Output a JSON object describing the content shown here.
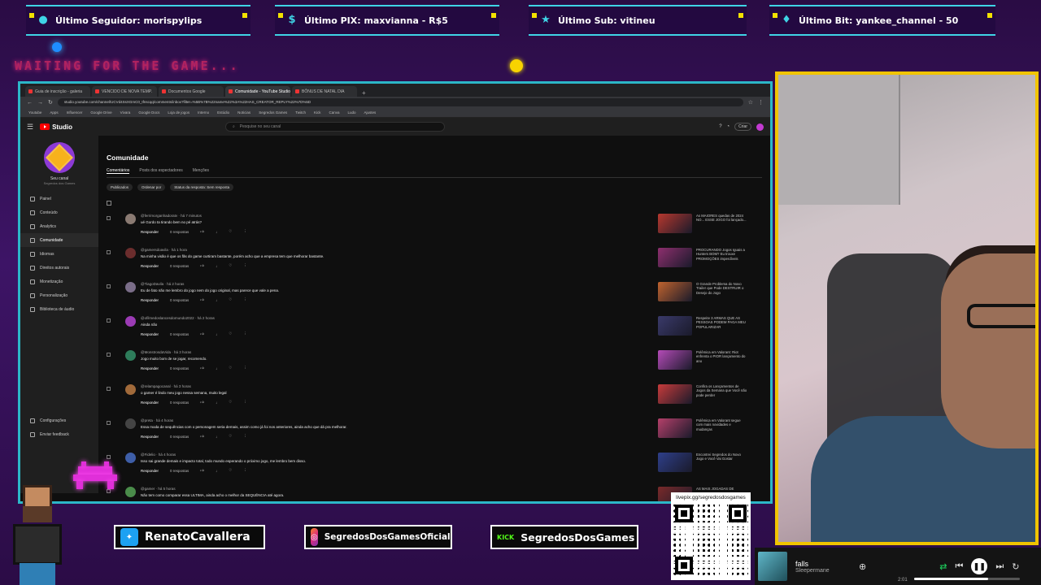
{
  "overlay": {
    "alerts": [
      {
        "icon": "user-icon",
        "label": "Último Seguidor: morispylips"
      },
      {
        "icon": "dollar-icon",
        "label": "Último PIX: maxvianna - R$5"
      },
      {
        "icon": "star-icon",
        "label": "Último Sub: vitineu"
      },
      {
        "icon": "diamond-icon",
        "label": "Último Bit: yankee_channel - 50"
      }
    ],
    "waiting_text": "WAITING FOR THE GAME...",
    "accent_color": "#3fd4e6",
    "frame_color": "#f1c400"
  },
  "browser": {
    "tabs": [
      {
        "label": "Guia de inscrição - galeria"
      },
      {
        "label": "VENCIDO DE NOVA TEMP."
      },
      {
        "label": "Documentos Google"
      },
      {
        "label": "Comunidade - YouTube Studio"
      },
      {
        "label": "BÔNUS DE NATAL DIA"
      }
    ],
    "url": "studio.youtube.com/channel/UCVd4SsXGmC0_tfnscqq/comments/inbox?filter=%5B%7B%22name%22%3A%22HAS_CREATOR_REPLY%22%7D%5D",
    "bookmarks": [
      "Youtube",
      "Apps",
      "Influencer",
      "Google Drive",
      "Vivara",
      "Google Docs",
      "Loja de jogos",
      "Interno",
      "Estúdio",
      "Noticias",
      "Segredos Games",
      "Twitch",
      "Kick",
      "Canva",
      "Ludo",
      "Ajustes"
    ]
  },
  "studio": {
    "logo_text": "Studio",
    "search_placeholder": "Pesquise no seu canal",
    "create_label": "Criar",
    "channel_name": "Seu canal",
    "channel_sub": "Segredos dos Games",
    "nav": [
      {
        "icon": "dashboard-icon",
        "label": "Painel"
      },
      {
        "icon": "content-icon",
        "label": "Conteúdo"
      },
      {
        "icon": "analytics-icon",
        "label": "Analytics"
      },
      {
        "icon": "community-icon",
        "label": "Comunidade"
      },
      {
        "icon": "subtitles-icon",
        "label": "Idiomas"
      },
      {
        "icon": "copyright-icon",
        "label": "Direitos autorais"
      },
      {
        "icon": "money-icon",
        "label": "Monetização"
      },
      {
        "icon": "brush-icon",
        "label": "Personalização"
      },
      {
        "icon": "audio-icon",
        "label": "Biblioteca de áudio"
      }
    ],
    "settings_label": "Configurações",
    "feedback_label": "Enviar feedback",
    "page_title": "Comunidade",
    "subtabs": [
      "Comentários",
      "Posts dos espectadores",
      "Menções"
    ],
    "filters": [
      "Publicados",
      "Ordenar por",
      "Status da resposta: Sem resposta"
    ],
    "reply_label": "Responder",
    "replies_label": "0 respostas",
    "comments": [
      {
        "author": "@ferrimorganhadoratv · há 7 minutos",
        "text": "ué Gordo ta tirando bem no pé atrás?",
        "avatar_color": "#8a7a72",
        "thumb_color": "#b7382e",
        "video": "As MAIORES quedas de 2024 NO... ESSE JOGO foi lançado..."
      },
      {
        "author": "@gamersdoavila · há 1 hora",
        "text": "Na minha visão é que os fãs do game curtiram bastante, porém acho que a empresa tem que melhorar bastante.",
        "avatar_color": "#6b2d2d",
        "thumb_color": "#8e2f6e",
        "video": "PROCURANDO Jogos Iguais a Hunters BOM? Eu trouxe PROMOÇÕES imperdíveis"
      },
      {
        "author": "@TiagoDavila · há 2 horas",
        "text": "Eu de fato não me lembro do jogo nem do jogo original, mas parece que vale a pena.",
        "avatar_color": "#7a6d88",
        "thumb_color": "#c0632e",
        "video": "O Grande Problema do Novo Trailer que Pode DESTRUIR o Desejo do Jogo"
      },
      {
        "author": "@ofilmedoslancesdomundo2022 · há 2 horas",
        "text": "Ainda não",
        "avatar_color": "#9b3bb4",
        "thumb_color": "#3a3a6a",
        "video": "Respeite 3 ARMAS QUE AS PESSOAS PODEM PAGA MEU POPULARIZAR"
      },
      {
        "author": "@MonstrosdaVida · há 3 horas",
        "text": "Jogo muito bom de se jogar, recomendo.",
        "avatar_color": "#2e7d5b",
        "thumb_color": "#b54bb8",
        "video": "Polêmica em Valorant: Riot enfrenta o PIOR lançamento do ano"
      },
      {
        "author": "@relampagocanal · há 3 horas",
        "text": "o gamer é lindo meu jogo nessa semana, muito legal",
        "avatar_color": "#a16a3a",
        "thumb_color": "#c73b3b",
        "video": "Confira os Lançamentos de Jogos da Semana que Você não pode perder"
      },
      {
        "author": "@preta · há 4 horas",
        "text": "Essa moda de sequências com o personagem seria demais, assim como já foi nos anteriores, ainda acho que dá pra melhorar.",
        "avatar_color": "#444444",
        "thumb_color": "#b5406a",
        "video": "Polêmica em Valorant segue com mais novidades e mudanças"
      },
      {
        "author": "@Fidelio · há 4 horas",
        "text": "Isso sai grande demais e impacto total, todo mundo esperando o próximo jogo, me lembro bem disso.",
        "avatar_color": "#3e5ea8",
        "thumb_color": "#2e3f8a",
        "video": "Encontrei Segredos do Novo Jogo e Você Vai Gostar"
      },
      {
        "author": "@gamer · há 5 horas",
        "text": "Não tem como comparar essa ULTIMA, ainda acho o melhor da SEQUÊNCIA até agora.",
        "avatar_color": "#4a8c4a",
        "thumb_color": "#7a2a2a",
        "video": "AS MAIS JOGADAS DE"
      }
    ]
  },
  "socials": [
    {
      "icon": "twitter-icon",
      "label": "RenatoCavallera"
    },
    {
      "icon": "instagram-icon",
      "label": "SegredosDosGamesOficial"
    },
    {
      "icon": "kick-icon",
      "badge": "KICK",
      "label": "SegredosDosGames"
    }
  ],
  "qr": {
    "label": "livepix.gg/segredosdosgames"
  },
  "music": {
    "title": "falls",
    "artist": "Sleepermane",
    "time": "2:01",
    "progress": 0.7
  }
}
